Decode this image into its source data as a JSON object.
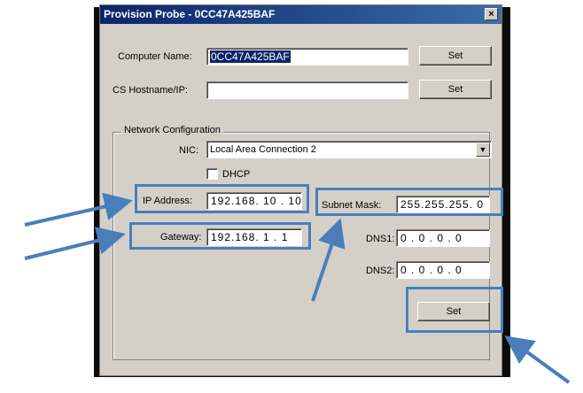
{
  "window": {
    "title": "Provision Probe - 0CC47A425BAF",
    "close_glyph": "×"
  },
  "computer_name": {
    "label": "Computer Name:",
    "value": "0CC47A425BAF",
    "button": "Set"
  },
  "cs_hostname": {
    "label": "CS Hostname/IP:",
    "value": "",
    "button": "Set"
  },
  "network": {
    "group_label": "Network Configuration",
    "nic": {
      "label": "NIC:",
      "value": "Local Area Connection 2",
      "arrow_glyph": "▼"
    },
    "dhcp": {
      "label": "DHCP",
      "checked": false
    },
    "ip_address": {
      "label": "IP Address:",
      "value": "192.168. 10 . 10"
    },
    "gateway": {
      "label": "Gateway:",
      "value": "192.168.  1  .  1"
    },
    "subnet_mask": {
      "label": "Subnet Mask:",
      "value": "255.255.255.  0"
    },
    "dns1": {
      "label": "DNS1:",
      "value": "0  .  0  .  0  .  0"
    },
    "dns2": {
      "label": "DNS2:",
      "value": "0  .  0  .  0  .  0"
    },
    "set_button": "Set"
  },
  "colors": {
    "highlight": "#4a7ebb",
    "titlebar": "#0a246a",
    "dialog_bg": "#d4d0c8"
  }
}
